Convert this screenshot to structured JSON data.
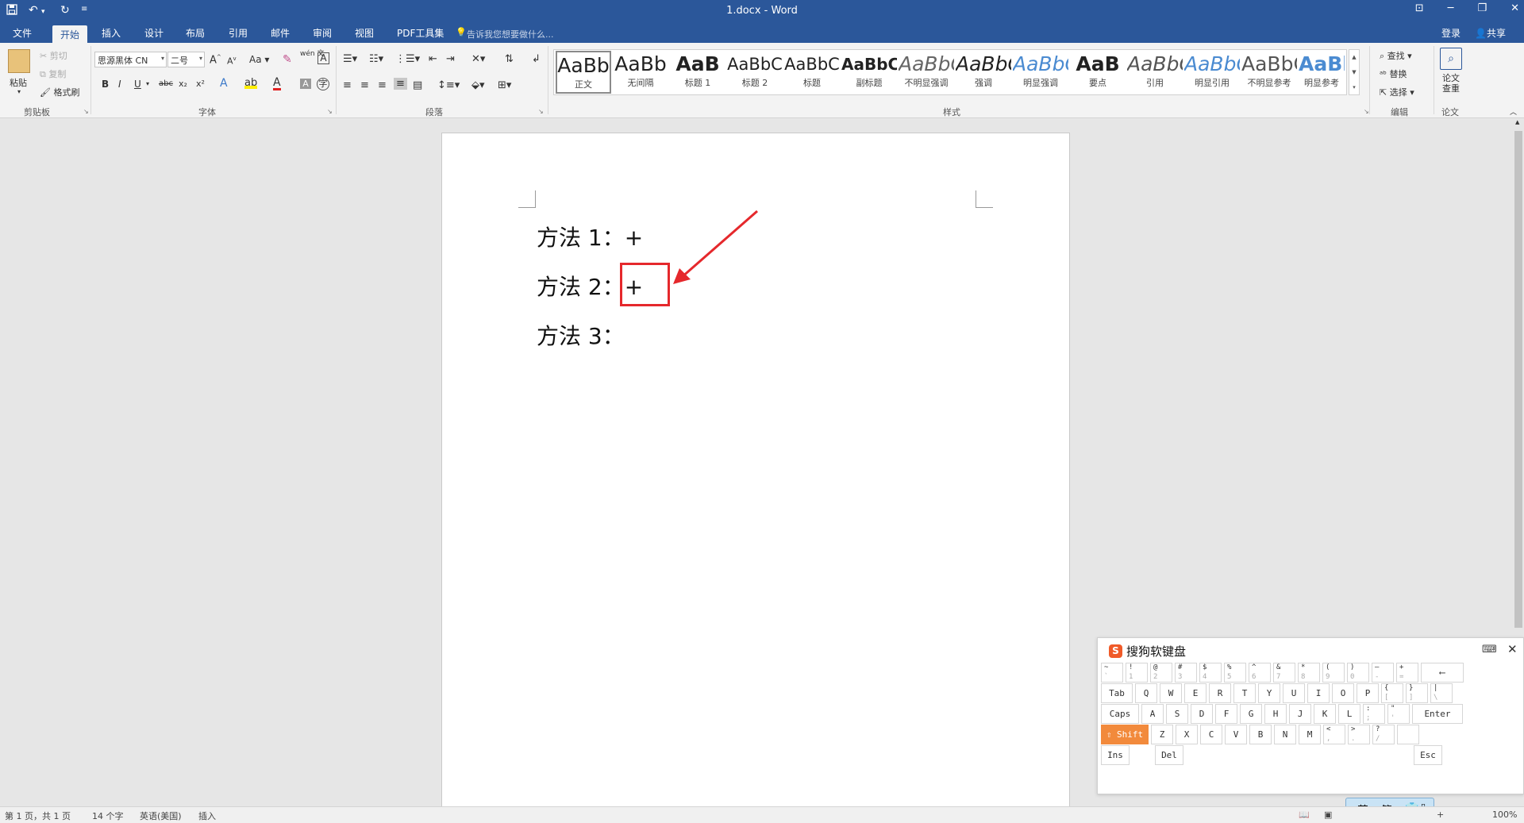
{
  "titlebar": {
    "quick_access": {
      "save_icon": "save-icon",
      "undo_icon": "undo-icon",
      "redo_icon": "redo-icon",
      "customize_icon": "customize-qat-icon"
    },
    "document_title": "1.docx - Word",
    "window_controls": {
      "ribbon_options": "ribbon-display-options-icon",
      "minimize": "minimize-icon",
      "restore": "restore-icon",
      "close": "close-icon"
    }
  },
  "tabs": [
    {
      "label": "文件"
    },
    {
      "label": "开始"
    },
    {
      "label": "插入"
    },
    {
      "label": "设计"
    },
    {
      "label": "布局"
    },
    {
      "label": "引用"
    },
    {
      "label": "邮件"
    },
    {
      "label": "审阅"
    },
    {
      "label": "视图"
    },
    {
      "label": "PDF工具集"
    }
  ],
  "active_tab": "开始",
  "tell_me": "告诉我您想要做什么...",
  "account": {
    "sign_in": "登录",
    "share": "共享"
  },
  "ribbon": {
    "clipboard": {
      "paste": "粘贴",
      "cut": "剪切",
      "copy": "复制",
      "format_painter": "格式刷",
      "label": "剪贴板"
    },
    "font": {
      "name": "思源黑体 CN",
      "size": "二号",
      "label": "字体",
      "grow": "A",
      "shrink": "A",
      "case": "Aa",
      "clear": "清除格式",
      "phonetic": "wén 文",
      "bold": "B",
      "italic": "I",
      "underline": "U",
      "strike": "abc",
      "subscript": "x₂",
      "superscript": "x²",
      "text_effects": "A",
      "font_color": "A",
      "char_shading": "A",
      "enclose": "字"
    },
    "paragraph": {
      "label": "段落"
    },
    "styles": {
      "label": "样式",
      "items": [
        {
          "preview": "AaBb",
          "name": "正文"
        },
        {
          "preview": "AaBb",
          "name": "无间隔"
        },
        {
          "preview": "AaB",
          "name": "标题 1"
        },
        {
          "preview": "AaBbC",
          "name": "标题 2"
        },
        {
          "preview": "AaBbC",
          "name": "标题"
        },
        {
          "preview": "AaBbC",
          "name": "副标题"
        },
        {
          "preview": "AaBbC",
          "name": "不明显强调"
        },
        {
          "preview": "AaBbC",
          "name": "强调"
        },
        {
          "preview": "AaBbC",
          "name": "明显强调"
        },
        {
          "preview": "AaB",
          "name": "要点"
        },
        {
          "preview": "AaBbC",
          "name": "引用"
        },
        {
          "preview": "AaBbC",
          "name": "明显引用"
        },
        {
          "preview": "AaBbC",
          "name": "不明显参考"
        },
        {
          "preview": "AaBbC",
          "name": "明显参考"
        }
      ]
    },
    "editing": {
      "find": "查找",
      "replace": "替换",
      "select": "选择",
      "label": "编辑"
    },
    "paper": {
      "check": "论文查重",
      "label": "论文"
    }
  },
  "document": {
    "lines": [
      "方法 1：+",
      "方法 2：+",
      "方法 3："
    ]
  },
  "annotation": {
    "color": "#e5282c"
  },
  "statusbar": {
    "page": "第 1 页，共 1 页",
    "words": "14 个字",
    "language": "英语(美国)",
    "mode": "插入",
    "zoom": "100%"
  },
  "soft_keyboard": {
    "title": "搜狗软键盘",
    "rows": [
      [
        {
          "u": "~",
          "d": "`"
        },
        {
          "u": "!",
          "d": "1"
        },
        {
          "u": "@",
          "d": "2"
        },
        {
          "u": "#",
          "d": "3"
        },
        {
          "u": "$",
          "d": "4"
        },
        {
          "u": "%",
          "d": "5"
        },
        {
          "u": "^",
          "d": "6"
        },
        {
          "u": "&",
          "d": "7"
        },
        {
          "u": "*",
          "d": "8"
        },
        {
          "u": "(",
          "d": "9"
        },
        {
          "u": ")",
          "d": "0"
        },
        {
          "u": "—",
          "d": "-"
        },
        {
          "u": "+",
          "d": "="
        },
        {
          "c": "⟵"
        }
      ],
      [
        {
          "c": "Tab"
        },
        {
          "c": "Q"
        },
        {
          "c": "W"
        },
        {
          "c": "E"
        },
        {
          "c": "R"
        },
        {
          "c": "T"
        },
        {
          "c": "Y"
        },
        {
          "c": "U"
        },
        {
          "c": "I"
        },
        {
          "c": "O"
        },
        {
          "c": "P"
        },
        {
          "u": "{",
          "d": "["
        },
        {
          "u": "}",
          "d": "]"
        },
        {
          "u": "|",
          "d": "\\"
        }
      ],
      [
        {
          "c": "Caps"
        },
        {
          "c": "A"
        },
        {
          "c": "S"
        },
        {
          "c": "D"
        },
        {
          "c": "F"
        },
        {
          "c": "G"
        },
        {
          "c": "H"
        },
        {
          "c": "J"
        },
        {
          "c": "K"
        },
        {
          "c": "L"
        },
        {
          "u": ":",
          "d": ";"
        },
        {
          "u": "\"",
          "d": "'"
        },
        {
          "c": "Enter"
        }
      ],
      [
        {
          "c": "⇧ Shift"
        },
        {
          "c": "Z"
        },
        {
          "c": "X"
        },
        {
          "c": "C"
        },
        {
          "c": "V"
        },
        {
          "c": "B"
        },
        {
          "c": "N"
        },
        {
          "c": "M"
        },
        {
          "u": "<",
          "d": ","
        },
        {
          "u": ">",
          "d": "."
        },
        {
          "u": "?",
          "d": "/"
        },
        {
          "c": ""
        }
      ],
      [
        {
          "c": "Ins"
        },
        {
          "c": "Del"
        },
        {
          "c": "Esc"
        }
      ]
    ],
    "ime": {
      "lang": "英",
      "script": "简",
      "skin": "skin-icon",
      "toolbox": "toolbox-icon"
    }
  }
}
